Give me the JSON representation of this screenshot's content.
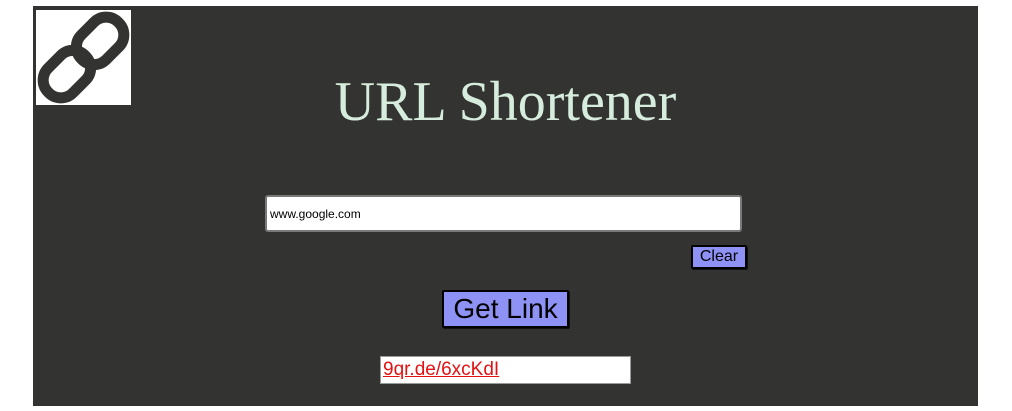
{
  "header": {
    "title": "URL Shortener",
    "logo_icon": "link-chain-icon"
  },
  "form": {
    "url_value": "www.google.com",
    "clear_label": "Clear",
    "submit_label": "Get Link"
  },
  "result": {
    "short_link": "9qr.de/6xcKdI"
  },
  "colors": {
    "background": "#333331",
    "title": "#d6ecdc",
    "button": "#8f92f5",
    "link": "#e31212"
  }
}
